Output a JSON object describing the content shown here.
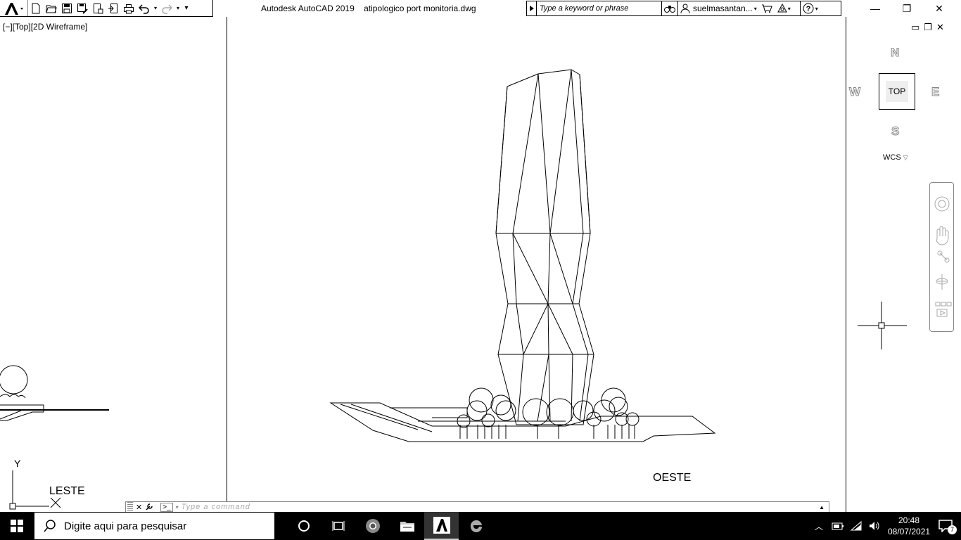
{
  "window": {
    "title": "Autodesk AutoCAD 2019",
    "file": "atipologico port monitoria.dwg",
    "minimize": "—",
    "maximize": "❐",
    "close": "✕"
  },
  "search": {
    "placeholder": "Type a keyword or phrase"
  },
  "user": {
    "name": "suelmasantan..."
  },
  "viewport": {
    "label": "[−][Top][2D Wireframe]"
  },
  "drawing": {
    "left_label": "LESTE",
    "right_label": "OESTE",
    "ucs_y": "Y"
  },
  "viewcube": {
    "north": "N",
    "south": "S",
    "west": "W",
    "east": "E",
    "face": "TOP",
    "wcs": "WCS"
  },
  "command": {
    "placeholder": "Type a command"
  },
  "taskbar": {
    "search_text": "Digite aqui para pesquisar",
    "time": "20:48",
    "date": "08/07/2021",
    "notifications": "7"
  }
}
